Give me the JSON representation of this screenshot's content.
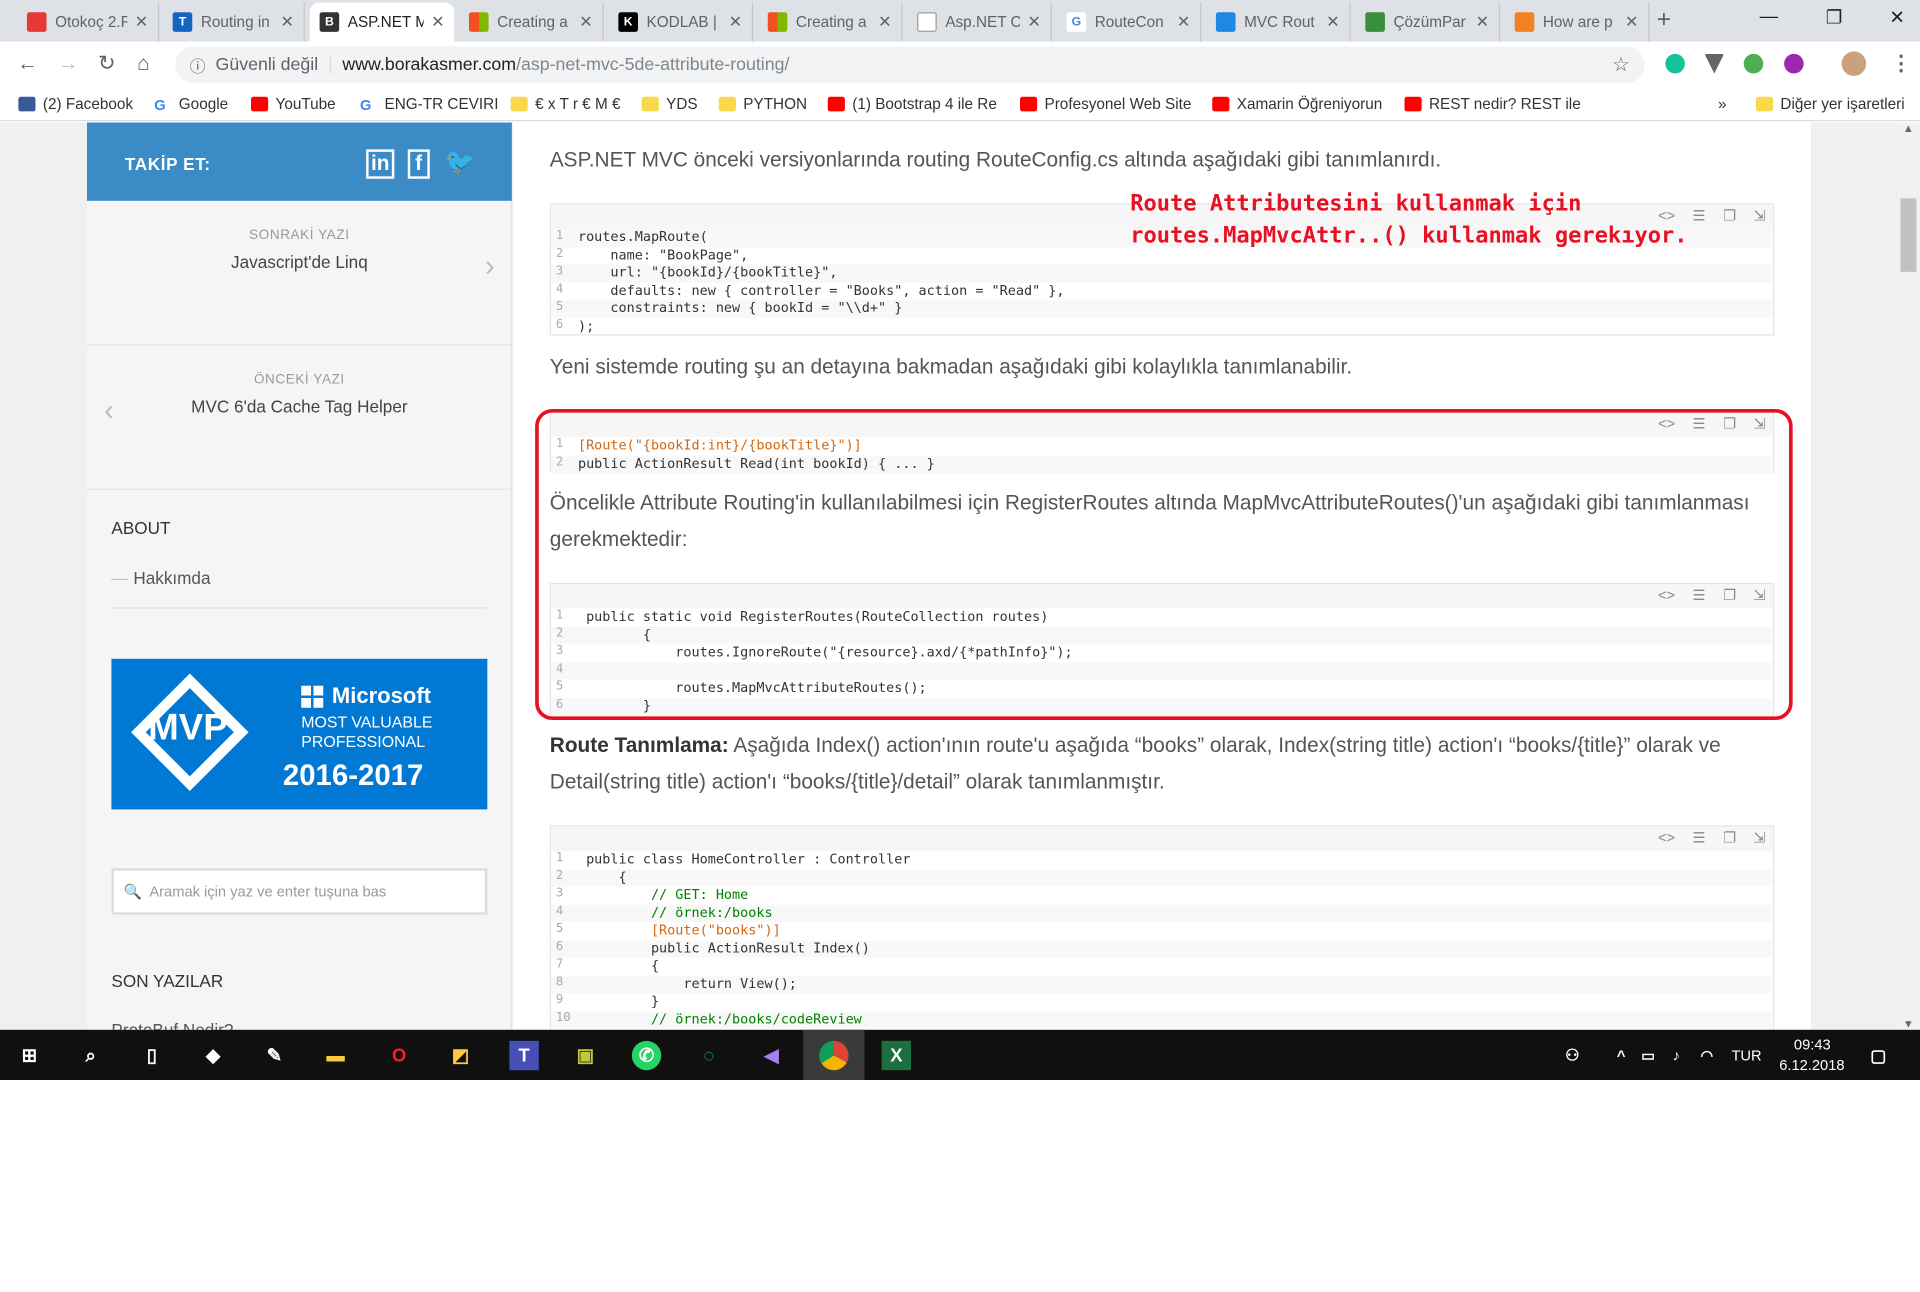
{
  "tabs": [
    {
      "label": "Otokoç 2.F",
      "icon_color": "#e53935"
    },
    {
      "label": "Routing in",
      "icon_color": "#1565c0"
    },
    {
      "label": "ASP.NET M",
      "icon_color": "#333333"
    },
    {
      "label": "Creating a",
      "icon_color": "#f25022"
    },
    {
      "label": "KODLAB |",
      "icon_color": "#000000"
    },
    {
      "label": "Creating a",
      "icon_color": "#f25022"
    },
    {
      "label": "Asp.NET C",
      "icon_color": "#9e9e9e"
    },
    {
      "label": "RouteCon",
      "icon_color": "#4285f4"
    },
    {
      "label": "MVC Rout",
      "icon_color": "#1e88e5"
    },
    {
      "label": "ÇözümPar",
      "icon_color": "#388e3c"
    },
    {
      "label": "How are p",
      "icon_color": "#f48024"
    }
  ],
  "address": {
    "security": "Güvenli değil",
    "domain": "www.borakasmer.com",
    "path": "/asp-net-mvc-5de-attribute-routing/"
  },
  "bookmarks": [
    {
      "label": "(2) Facebook",
      "color": "#3b5998"
    },
    {
      "label": "Google",
      "color": "#4285f4"
    },
    {
      "label": "YouTube",
      "color": "#ff0000"
    },
    {
      "label": "ENG-TR CEVIRI",
      "color": "#4285f4"
    },
    {
      "label": "€ x T r € M €",
      "color": "#f9d849"
    },
    {
      "label": "YDS",
      "color": "#f9d849"
    },
    {
      "label": "PYTHON",
      "color": "#f9d849"
    },
    {
      "label": "(1) Bootstrap 4 ile Re",
      "color": "#ff0000"
    },
    {
      "label": "Profesyonel Web Site",
      "color": "#ff0000"
    },
    {
      "label": "Xamarin Öğreniyorun",
      "color": "#ff0000"
    },
    {
      "label": "REST nedir? REST ile",
      "color": "#ff0000"
    }
  ],
  "bookmarks_more": "»",
  "other_bookmarks": "Diğer yer işaretleri",
  "sidebar": {
    "follow_label": "TAKİP ET:",
    "next_label": "SONRAKİ YAZI",
    "next_title": "Javascript'de Linq",
    "prev_label": "ÖNCEKİ YAZI",
    "prev_title": "MVC 6'da Cache Tag Helper",
    "about_title": "ABOUT",
    "about_link": "Hakkımda",
    "mvp": {
      "brand": "Microsoft",
      "line1": "MOST VALUABLE",
      "line2": "PROFESSIONAL",
      "years": "2016-2017",
      "badge": "MVP"
    },
    "search_placeholder": "Aramak için yaz ve enter tuşuna bas",
    "recent_title": "SON YAZILAR",
    "recent_item": "ProtoBuf Nedir?"
  },
  "content": {
    "p1": "ASP.NET MVC önceki versiyonlarında routing RouteConfig.cs altında aşağıdaki gibi tanımlanırdı.",
    "p2": "Yeni sistemde routing şu an detayına bakmadan aşağıdaki gibi kolaylıkla tanımlanabilir.",
    "p3": "Öncelikle Attribute Routing'in kullanılabilmesi için RegisterRoutes altında MapMvcAttributeRoutes()'un aşağıdaki gibi tanımlanması gerekmektedir:",
    "p4_bold": "Route Tanımlama:",
    "p4": " Aşağıda Index() action'ının route'u aşağıda “books” olarak, Index(string title) action'ı “books/{title}” olarak ve Detail(string title) action'ı “books/{title}/detail” olarak tanımlanmıştır.",
    "annotation_line1": "Route Attributesini kullanmak için",
    "annotation_line2": "routes.MapMvcAttr..() kullanmak gerekıyor."
  },
  "code1": [
    "routes.MapRoute(",
    "    name: \"BookPage\",",
    "    url: \"{bookId}/{bookTitle}\",",
    "    defaults: new { controller = \"Books\", action = \"Read\" },",
    "    constraints: new { bookId = \"\\\\d+\" }",
    ");"
  ],
  "code2": [
    "[Route(\"{bookId:int}/{bookTitle}\")]",
    "public ActionResult Read(int bookId) { ... }"
  ],
  "code3": [
    " public static void RegisterRoutes(RouteCollection routes)",
    "        {",
    "            routes.IgnoreRoute(\"{resource}.axd/{*pathInfo}\");",
    "",
    "            routes.MapMvcAttributeRoutes();",
    "        }"
  ],
  "code4": [
    " public class HomeController : Controller",
    "     {",
    "         // GET: Home",
    "         // örnek:/books",
    "         [Route(\"books\")]",
    "         public ActionResult Index()",
    "         {",
    "             return View();",
    "         }",
    "         // örnek:/books/codeReview"
  ],
  "taskbar": {
    "lang": "TUR",
    "time": "09:43",
    "date": "6.12.2018"
  }
}
